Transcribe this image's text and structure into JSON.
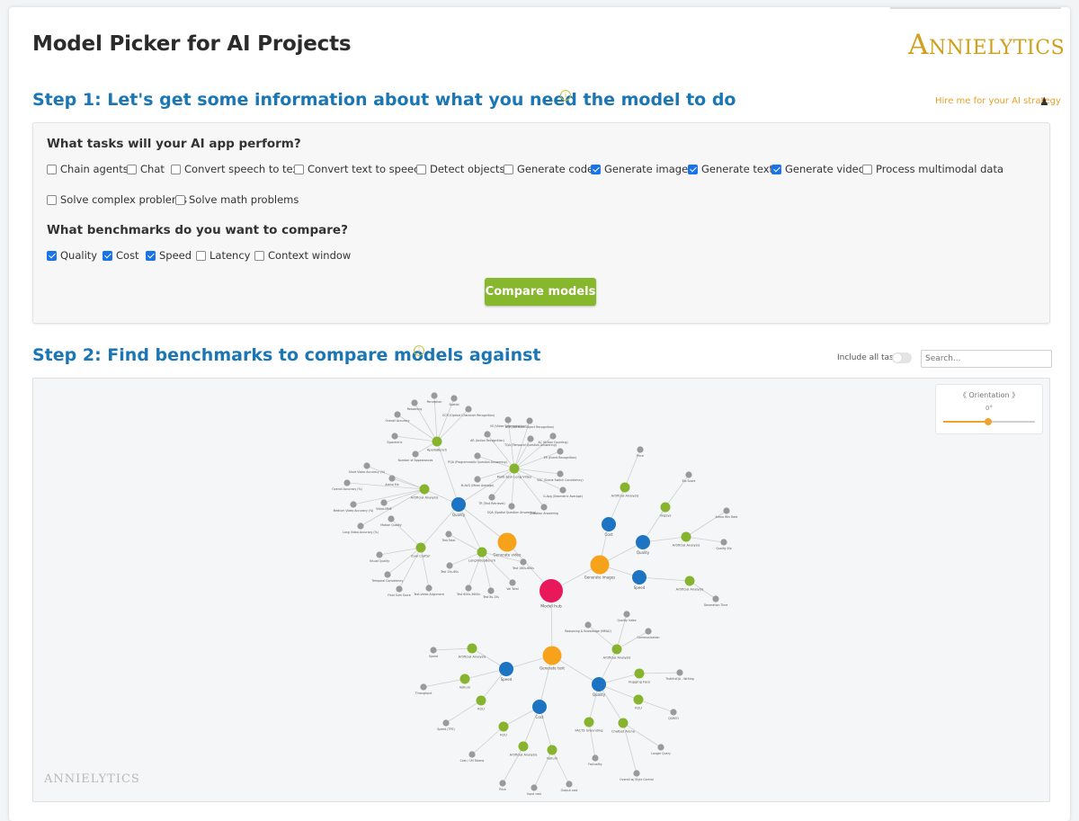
{
  "header": {
    "title": "Model Picker for AI Projects",
    "logo_text": "ANNIELYTICS",
    "logo_initial": "A",
    "logo_rest": "NNIELYTICS"
  },
  "step1": {
    "title": "Step 1: Let's get some information about what you need the model to do",
    "info_icon": "info-icon",
    "hire_link": "Hire me for your AI strategy",
    "hire_icon": "chess-pawn-icon",
    "tasks_question": "What tasks will your AI app perform?",
    "tasks": [
      {
        "label": "Chain agents",
        "checked": false
      },
      {
        "label": "Chat",
        "checked": false
      },
      {
        "label": "Convert speech to text",
        "checked": false
      },
      {
        "label": "Convert text to speech",
        "checked": false
      },
      {
        "label": "Detect objects",
        "checked": false
      },
      {
        "label": "Generate code",
        "checked": false
      },
      {
        "label": "Generate images",
        "checked": true
      },
      {
        "label": "Generate text",
        "checked": true
      },
      {
        "label": "Generate video",
        "checked": true
      },
      {
        "label": "Process multimodal data",
        "checked": false
      },
      {
        "label": "Solve complex problems",
        "checked": false
      },
      {
        "label": "Solve math problems",
        "checked": false
      }
    ],
    "benchmarks_question": "What benchmarks do you want to compare?",
    "benchmarks": [
      {
        "label": "Quality",
        "checked": true
      },
      {
        "label": "Cost",
        "checked": true
      },
      {
        "label": "Speed",
        "checked": true
      },
      {
        "label": "Latency",
        "checked": false
      },
      {
        "label": "Context window",
        "checked": false
      }
    ],
    "compare_button": "Compare models"
  },
  "step2": {
    "title": "Step 2: Find benchmarks to compare models against",
    "include_all_label": "Include all tasks",
    "include_all_on": false,
    "search_placeholder": "Search...",
    "orientation_label": "《 Orientation 》",
    "orientation_value": "0°",
    "orientation_fraction": 0.5,
    "watermark": "ANNIELYTICS"
  },
  "colors": {
    "root": "#e8185b",
    "task": "#f7a21b",
    "benchmark": "#1c74c2",
    "source": "#86b42e",
    "metric": "#9a9a9a",
    "edge": "#cfcfcf",
    "accent": "#1a76b5",
    "button": "#87b72d"
  },
  "graph": {
    "nodes": [
      {
        "id": "root",
        "label": "Model hub",
        "type": "root"
      },
      {
        "id": "gv",
        "label": "Generate video",
        "type": "task"
      },
      {
        "id": "gi",
        "label": "Generate images",
        "type": "task"
      },
      {
        "id": "gt",
        "label": "Generate text",
        "type": "task"
      },
      {
        "id": "vq",
        "label": "Quality",
        "type": "benchmark"
      },
      {
        "id": "ic",
        "label": "Cost",
        "type": "benchmark"
      },
      {
        "id": "iq",
        "label": "Quality",
        "type": "benchmark"
      },
      {
        "id": "isp",
        "label": "Speed",
        "type": "benchmark"
      },
      {
        "id": "tsp",
        "label": "Speed",
        "type": "benchmark"
      },
      {
        "id": "tc",
        "label": "Cost",
        "type": "benchmark"
      },
      {
        "id": "tq",
        "label": "Quality",
        "type": "benchmark"
      },
      {
        "id": "apo",
        "label": "ApolloBench",
        "type": "source"
      },
      {
        "id": "mtlv",
        "label": "Multi-task Long Video",
        "type": "source"
      },
      {
        "id": "aav",
        "label": "Artificial Analysis",
        "type": "source"
      },
      {
        "id": "evc",
        "label": "Eval Crafter",
        "type": "source"
      },
      {
        "id": "lvb",
        "label": "LongVideoBench",
        "type": "source"
      },
      {
        "id": "aai",
        "label": "Artificial Analysis",
        "type": "source"
      },
      {
        "id": "img",
        "label": "imgsys",
        "type": "source"
      },
      {
        "id": "aaq",
        "label": "Artificial Analysis",
        "type": "source"
      },
      {
        "id": "aas",
        "label": "Artificial Analysis",
        "type": "source"
      },
      {
        "id": "aat",
        "label": "Artificial Analysis",
        "type": "source"
      },
      {
        "id": "vel",
        "label": "Vellum",
        "type": "source"
      },
      {
        "id": "r1",
        "label": "R2U",
        "type": "source"
      },
      {
        "id": "r2",
        "label": "R2U",
        "type": "source"
      },
      {
        "id": "aac",
        "label": "Artificial Analysis",
        "type": "source"
      },
      {
        "id": "vel2",
        "label": "Vellum",
        "type": "source"
      },
      {
        "id": "aaq2",
        "label": "Artificial Analysis",
        "type": "source"
      },
      {
        "id": "hf",
        "label": "Hugging Face",
        "type": "source"
      },
      {
        "id": "r3",
        "label": "R2U",
        "type": "source"
      },
      {
        "id": "fg",
        "label": "FACTS Grounding",
        "type": "source"
      },
      {
        "id": "ca",
        "label": "Chatbot Arena",
        "type": "source"
      },
      {
        "id": "m1",
        "label": "Perception",
        "type": "metric"
      },
      {
        "id": "m2",
        "label": "Reasoning",
        "type": "metric"
      },
      {
        "id": "m3",
        "label": "Spatial",
        "type": "metric"
      },
      {
        "id": "m4",
        "label": "OCR (Optical Character Recognition)",
        "type": "metric"
      },
      {
        "id": "m5",
        "label": "Overall Accuracy",
        "type": "metric"
      },
      {
        "id": "m6",
        "label": "Egocentric",
        "type": "metric"
      },
      {
        "id": "m7",
        "label": "Number of Appearances",
        "type": "metric"
      },
      {
        "id": "m8",
        "label": "AOI (Attribute Object Recognition)",
        "type": "metric"
      },
      {
        "id": "m9",
        "label": "VS (Video Segmentation)",
        "type": "metric"
      },
      {
        "id": "m10",
        "label": "AR (Action Recognition)",
        "type": "metric"
      },
      {
        "id": "m11",
        "label": "AC (Action Counting)",
        "type": "metric"
      },
      {
        "id": "m12",
        "label": "TQA (Temporal Question Answering)",
        "type": "metric"
      },
      {
        "id": "m13",
        "label": "ER (Event Recognition)",
        "type": "metric"
      },
      {
        "id": "m14",
        "label": "PQA (Programmatic Question Answering)",
        "type": "metric"
      },
      {
        "id": "m15",
        "label": "SSC (Scene Switch Consistency)",
        "type": "metric"
      },
      {
        "id": "m16",
        "label": "M-AVG (Mean Average)",
        "type": "metric"
      },
      {
        "id": "m17",
        "label": "G-Avg (Geometric Average)",
        "type": "metric"
      },
      {
        "id": "m18",
        "label": "TR (Text Retrieval)",
        "type": "metric"
      },
      {
        "id": "m19",
        "label": "SQA (Spatial Question Answering)",
        "type": "metric"
      },
      {
        "id": "m20",
        "label": "Question Answering",
        "type": "metric"
      },
      {
        "id": "m21",
        "label": "Short Video Accuracy (%)",
        "type": "metric"
      },
      {
        "id": "m22",
        "label": "Arena Elo",
        "type": "metric"
      },
      {
        "id": "m23",
        "label": "Overall Accuracy (%)",
        "type": "metric"
      },
      {
        "id": "m24",
        "label": "Medium Video Accuracy (%)",
        "type": "metric"
      },
      {
        "id": "m25",
        "label": "Video-MME",
        "type": "metric"
      },
      {
        "id": "m26",
        "label": "Long Video Accuracy (%)",
        "type": "metric"
      },
      {
        "id": "m27",
        "label": "Motion Quality",
        "type": "metric"
      },
      {
        "id": "m28",
        "label": "Visual Quality",
        "type": "metric"
      },
      {
        "id": "m29",
        "label": "Temporal Consistency",
        "type": "metric"
      },
      {
        "id": "m30",
        "label": "Final Sum Score",
        "type": "metric"
      },
      {
        "id": "m31",
        "label": "Text-Video Alignment",
        "type": "metric"
      },
      {
        "id": "m32",
        "label": "Test Total",
        "type": "metric"
      },
      {
        "id": "m33",
        "label": "Test 15s-60s",
        "type": "metric"
      },
      {
        "id": "m34",
        "label": "Test 600s-3600s",
        "type": "metric"
      },
      {
        "id": "m35",
        "label": "Test 8s-15s",
        "type": "metric"
      },
      {
        "id": "m36",
        "label": "Test 180s-600s",
        "type": "metric"
      },
      {
        "id": "m37",
        "label": "Val Total",
        "type": "metric"
      },
      {
        "id": "m38",
        "label": "Price",
        "type": "metric"
      },
      {
        "id": "m39",
        "label": "Elo Score",
        "type": "metric"
      },
      {
        "id": "m40",
        "label": "Arena Win Rate",
        "type": "metric"
      },
      {
        "id": "m41",
        "label": "Quality Elo",
        "type": "metric"
      },
      {
        "id": "m42",
        "label": "Generation Time",
        "type": "metric"
      },
      {
        "id": "m43",
        "label": "Quality Index",
        "type": "metric"
      },
      {
        "id": "m44",
        "label": "Reasoning & Knowledge (MMLU)",
        "type": "metric"
      },
      {
        "id": "m45",
        "label": "Communication",
        "type": "metric"
      },
      {
        "id": "m46",
        "label": "TruthfulQA - Writing",
        "type": "metric"
      },
      {
        "id": "m47",
        "label": "Speed",
        "type": "metric"
      },
      {
        "id": "m48",
        "label": "Throughput",
        "type": "metric"
      },
      {
        "id": "m49",
        "label": "Speed (TPS)",
        "type": "metric"
      },
      {
        "id": "m50",
        "label": "Cost / 1M Tokens",
        "type": "metric"
      },
      {
        "id": "m51",
        "label": "Price",
        "type": "metric"
      },
      {
        "id": "m52",
        "label": "Input cost",
        "type": "metric"
      },
      {
        "id": "m53",
        "label": "Output cost",
        "type": "metric"
      },
      {
        "id": "m54",
        "label": "Factuality",
        "type": "metric"
      },
      {
        "id": "m55",
        "label": "Overall w/ Style Control",
        "type": "metric"
      },
      {
        "id": "m56",
        "label": "Longer Query",
        "type": "metric"
      },
      {
        "id": "m57",
        "label": "QGREO",
        "type": "metric"
      }
    ]
  }
}
